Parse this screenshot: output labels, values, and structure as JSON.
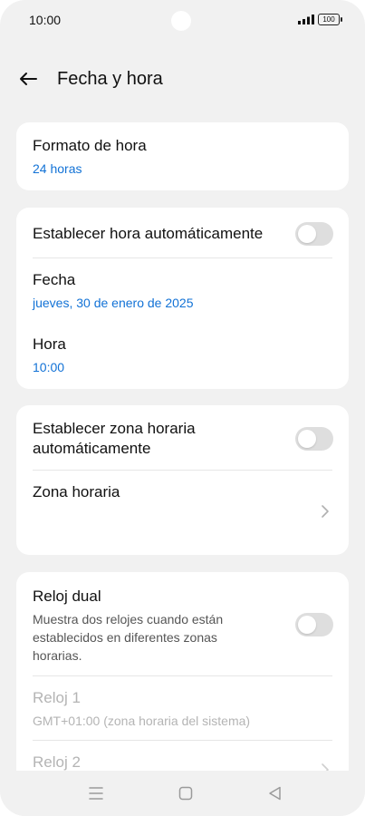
{
  "status": {
    "time": "10:00",
    "battery": "100"
  },
  "header": {
    "title": "Fecha y hora",
    "back_icon": "arrow-left-icon"
  },
  "format": {
    "label": "Formato de hora",
    "value": "24 horas"
  },
  "auto_time": {
    "label": "Establecer hora automáticamente",
    "enabled": false
  },
  "date": {
    "label": "Fecha",
    "value": "jueves, 30 de enero de 2025"
  },
  "time_setting": {
    "label": "Hora",
    "value": "10:00"
  },
  "auto_zone": {
    "label_line1": "Establecer zona horaria",
    "label_line2": "automáticamente",
    "enabled": false
  },
  "zone": {
    "label": "Zona horaria"
  },
  "dual": {
    "label": "Reloj dual",
    "desc_line1": "Muestra dos relojes cuando están",
    "desc_line2": "establecidos en diferentes zonas",
    "desc_line3": "horarias.",
    "enabled": false
  },
  "clock1": {
    "label": "Reloj 1",
    "value": "GMT+01:00 (zona horaria del sistema)"
  },
  "clock2": {
    "label": "Reloj 2"
  },
  "colors": {
    "accent": "#1272d6",
    "background": "#f1f1f1",
    "card": "#ffffff"
  }
}
